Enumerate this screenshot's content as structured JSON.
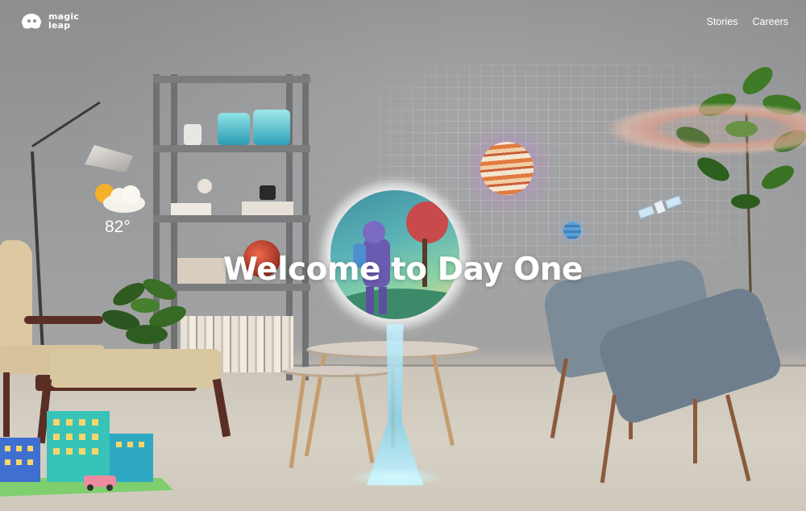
{
  "brand": {
    "name": "magic\nleap"
  },
  "nav": {
    "items": [
      "Stories",
      "Careers"
    ]
  },
  "hero": {
    "title": "Welcome to Day One"
  },
  "weather": {
    "temperature": "82°",
    "icon": "sun-cloud-icon"
  },
  "icons": {
    "logo": "magic-leap-logo-icon"
  },
  "colors": {
    "text": "#ffffff",
    "wall": "#9a9b9d",
    "floor": "#d6d0c5"
  }
}
